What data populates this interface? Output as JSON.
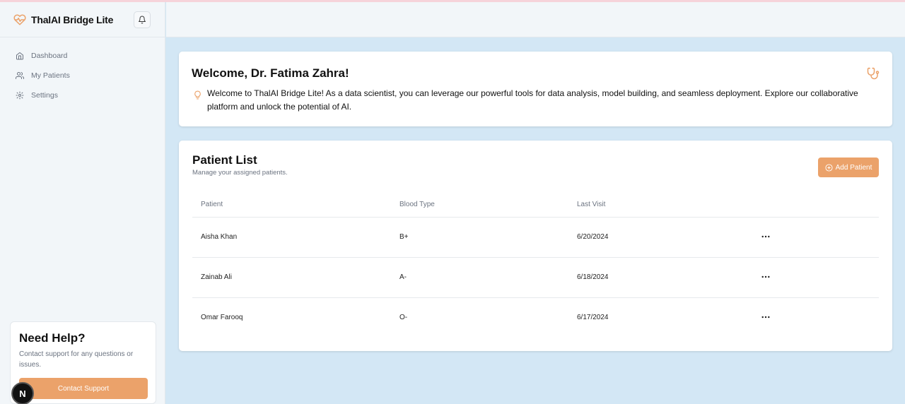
{
  "app": {
    "name": "ThalAI Bridge Lite"
  },
  "sidebar": {
    "items": [
      {
        "label": "Dashboard",
        "icon": "home-icon"
      },
      {
        "label": "My Patients",
        "icon": "users-icon"
      },
      {
        "label": "Settings",
        "icon": "gear-icon"
      }
    ],
    "help": {
      "title": "Need Help?",
      "text": "Contact support for any questions or issues.",
      "button": "Contact Support"
    }
  },
  "welcome": {
    "title": "Welcome, Dr. Fatima Zahra!",
    "text": "Welcome to ThalAI Bridge Lite! As a data scientist, you can leverage our powerful tools for data analysis, model building, and seamless deployment. Explore our collaborative platform and unlock the potential of AI."
  },
  "patients": {
    "title": "Patient List",
    "subtitle": "Manage your assigned patients.",
    "add_button": "Add Patient",
    "columns": [
      "Patient",
      "Blood Type",
      "Last Visit"
    ],
    "rows": [
      {
        "name": "Aisha Khan",
        "blood": "B+",
        "visit": "6/20/2024"
      },
      {
        "name": "Zainab Ali",
        "blood": "A-",
        "visit": "6/18/2024"
      },
      {
        "name": "Omar Farooq",
        "blood": "O-",
        "visit": "6/17/2024"
      }
    ]
  },
  "badge": {
    "letter": "N"
  },
  "colors": {
    "accent": "#eba26a",
    "background": "#d3e7f5",
    "sidebar": "#f2f6f9"
  }
}
